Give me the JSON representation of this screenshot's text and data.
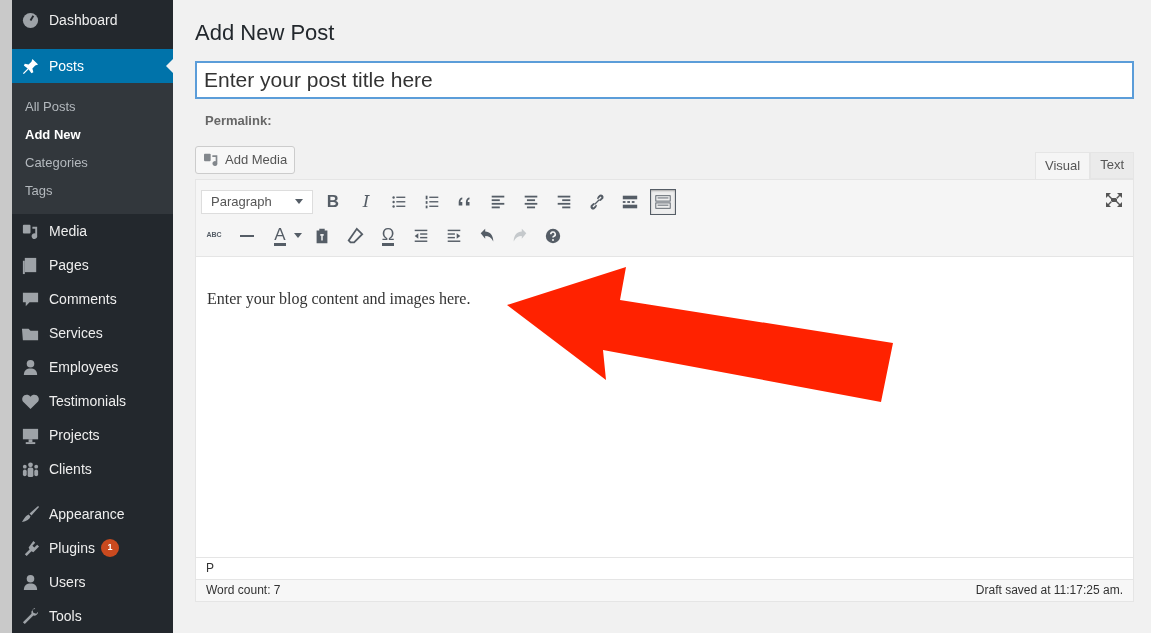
{
  "sidebar": {
    "items": [
      {
        "label": "Dashboard",
        "selected": false
      },
      {
        "label": "Posts",
        "selected": true,
        "children": [
          {
            "label": "All Posts",
            "selected": false
          },
          {
            "label": "Add New",
            "selected": true
          },
          {
            "label": "Categories",
            "selected": false
          },
          {
            "label": "Tags",
            "selected": false
          }
        ]
      },
      {
        "label": "Media",
        "selected": false
      },
      {
        "label": "Pages",
        "selected": false
      },
      {
        "label": "Comments",
        "selected": false
      },
      {
        "label": "Services",
        "selected": false
      },
      {
        "label": "Employees",
        "selected": false
      },
      {
        "label": "Testimonials",
        "selected": false
      },
      {
        "label": "Projects",
        "selected": false
      },
      {
        "label": "Clients",
        "selected": false
      },
      {
        "label": "Appearance",
        "selected": false
      },
      {
        "label": "Plugins",
        "selected": false,
        "badge": "1"
      },
      {
        "label": "Users",
        "selected": false
      },
      {
        "label": "Tools",
        "selected": false
      }
    ]
  },
  "page": {
    "title": "Add New Post",
    "post_title": {
      "placeholder": "Enter your post title here"
    },
    "permalink_label": "Permalink:"
  },
  "editor": {
    "add_media": "Add Media",
    "tabs": [
      {
        "label": "Visual",
        "selected": true
      },
      {
        "label": "Text",
        "selected": false
      }
    ],
    "format_select": "Paragraph",
    "toolbar_row_1": [
      {
        "kind": "glyph",
        "text": "B",
        "pressed": false
      },
      {
        "kind": "glyph",
        "text": "I",
        "pressed": false
      },
      {
        "kind": "icon",
        "pressed": false
      },
      {
        "kind": "icon",
        "pressed": false
      },
      {
        "kind": "icon",
        "pressed": false
      },
      {
        "kind": "icon",
        "pressed": false
      },
      {
        "kind": "icon",
        "pressed": false
      },
      {
        "kind": "icon",
        "pressed": false
      },
      {
        "kind": "icon",
        "pressed": false
      },
      {
        "kind": "icon",
        "pressed": false
      },
      {
        "kind": "icon",
        "pressed": true
      }
    ],
    "toolbar_row_2": [
      {
        "kind": "glyph",
        "text": "ABC",
        "disabled": false
      },
      {
        "kind": "icon",
        "disabled": false
      },
      {
        "kind": "glyph",
        "text": "A",
        "disabled": false
      },
      {
        "kind": "icon",
        "disabled": false
      },
      {
        "kind": "icon",
        "disabled": false
      },
      {
        "kind": "glyph",
        "text": "Ω",
        "disabled": false
      },
      {
        "kind": "icon",
        "disabled": false
      },
      {
        "kind": "icon",
        "disabled": false
      },
      {
        "kind": "icon",
        "disabled": false
      },
      {
        "kind": "icon",
        "disabled": true
      },
      {
        "kind": "icon",
        "disabled": false
      }
    ],
    "content": "Enter your blog content and images here.",
    "path": "P",
    "word_count": "Word count: 7",
    "draft_saved": "Draft saved at 11:17:25 am."
  }
}
